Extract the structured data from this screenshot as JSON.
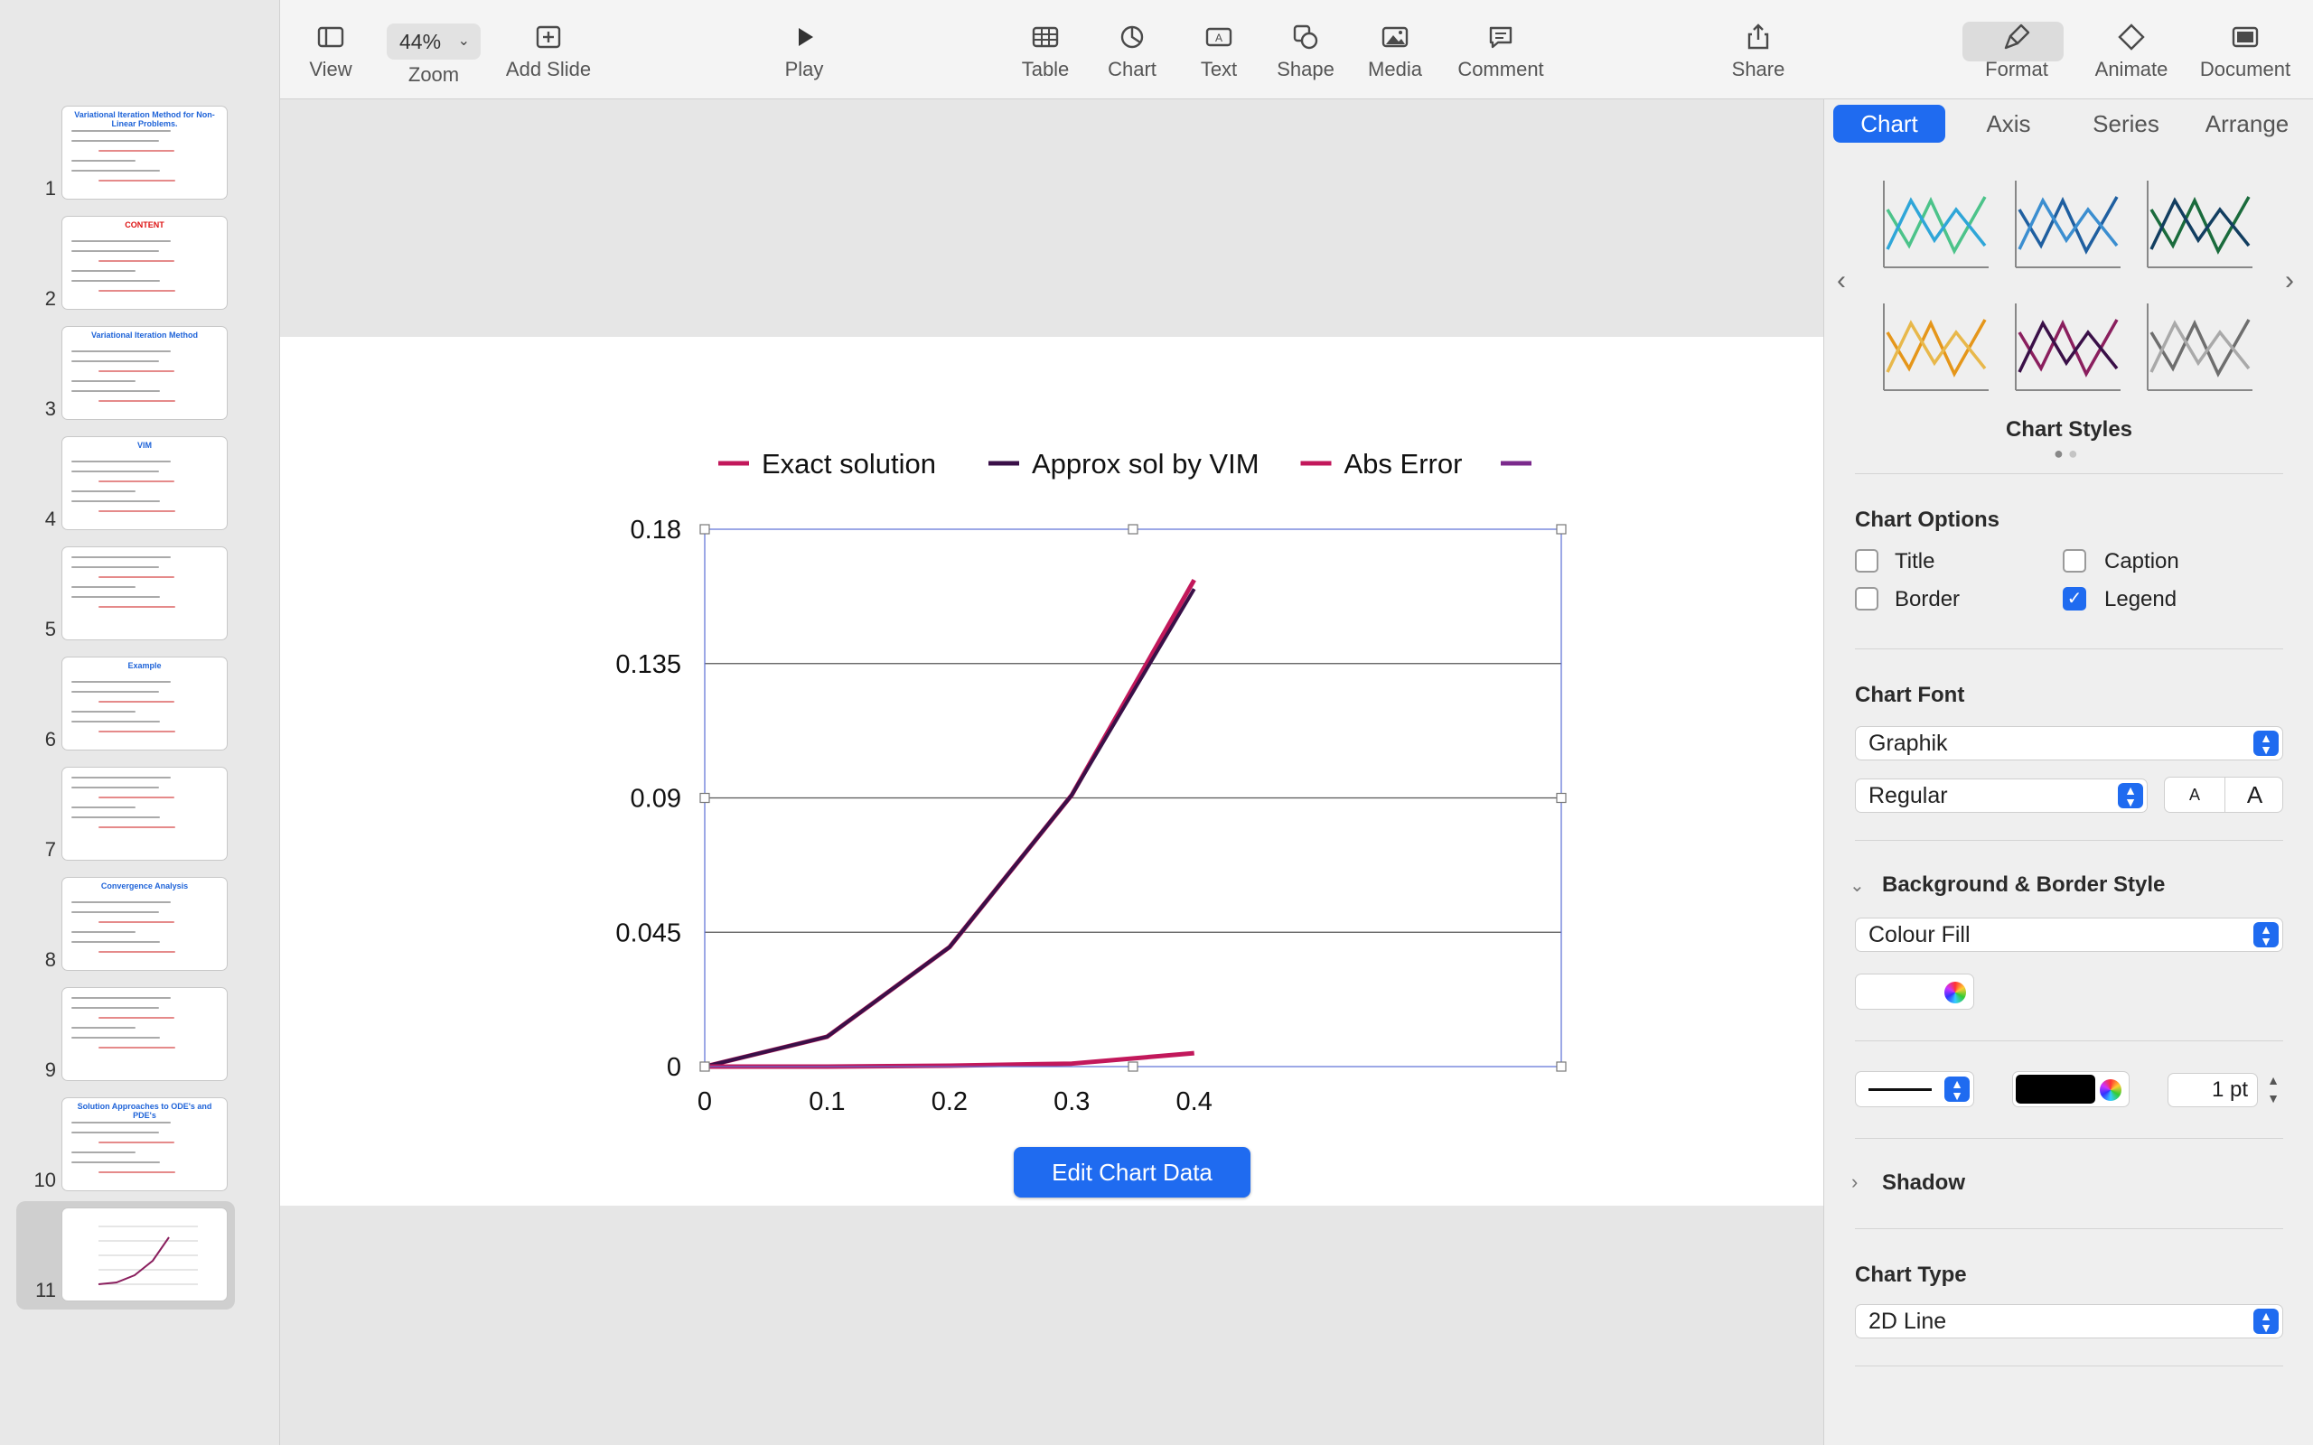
{
  "toolbar": {
    "view": "View",
    "zoom_label": "Zoom",
    "zoom_value": "44%",
    "add_slide": "Add Slide",
    "play": "Play",
    "table": "Table",
    "chart": "Chart",
    "text": "Text",
    "shape": "Shape",
    "media": "Media",
    "comment": "Comment",
    "share": "Share",
    "format": "Format",
    "animate": "Animate",
    "document": "Document"
  },
  "slides": {
    "numbers": [
      "1",
      "2",
      "3",
      "4",
      "5",
      "6",
      "7",
      "8",
      "9",
      "10",
      "11"
    ],
    "titles": [
      "Variational Iteration Method for Non-Linear Problems.",
      "CONTENT",
      "Variational Iteration Method",
      "VIM",
      "",
      "Example",
      "",
      "Convergence Analysis",
      "",
      "Solution Approaches to ODE's and PDE's",
      ""
    ],
    "selected": "11"
  },
  "chart_data": {
    "type": "line",
    "x": [
      0,
      0.1,
      0.2,
      0.3,
      0.4
    ],
    "xlabels": [
      "0",
      "0.1",
      "0.2",
      "0.3",
      "0.4"
    ],
    "ylabels": [
      "0",
      "0.045",
      "0.09",
      "0.135",
      "0.18"
    ],
    "ylim": [
      0,
      0.18
    ],
    "xlim": [
      0,
      0.7
    ],
    "grid": true,
    "legend_position": "top",
    "series": [
      {
        "name": "Exact solution",
        "color": "#c2185b",
        "values": [
          0,
          0.01,
          0.04,
          0.091,
          0.163
        ]
      },
      {
        "name": "Approx sol by VIM",
        "color": "#3a1048",
        "values": [
          0,
          0.01,
          0.04,
          0.091,
          0.16
        ]
      },
      {
        "name": "Abs Error",
        "color": "#c2185b",
        "values": [
          0,
          0,
          0.0003,
          0.001,
          0.0045
        ]
      },
      {
        "name": "",
        "color": "#7b2a8c",
        "values": []
      }
    ]
  },
  "edit_chart_data": "Edit Chart Data",
  "inspector": {
    "tabs": [
      "Chart",
      "Axis",
      "Series",
      "Arrange"
    ],
    "chart_styles": "Chart Styles",
    "chart_options": "Chart Options",
    "options": {
      "title": "Title",
      "caption": "Caption",
      "border": "Border",
      "legend": "Legend"
    },
    "chart_font": "Chart Font",
    "font_name": "Graphik",
    "font_style": "Regular",
    "font_small": "A",
    "font_large": "A",
    "bg_border_style": "Background & Border Style",
    "fill": "Colour Fill",
    "stroke_width": "1 pt",
    "shadow": "Shadow",
    "chart_type": "Chart Type",
    "chart_type_value": "2D Line",
    "style_palettes": [
      [
        "#4cc38a",
        "#2fa6d8"
      ],
      [
        "#1f5fa0",
        "#3b8ed0"
      ],
      [
        "#1a6b3c",
        "#123e60"
      ],
      [
        "#e5961a",
        "#e8b84b"
      ],
      [
        "#8a1f5e",
        "#3a1048"
      ],
      [
        "#6e6e6e",
        "#a9a9a9"
      ]
    ]
  }
}
